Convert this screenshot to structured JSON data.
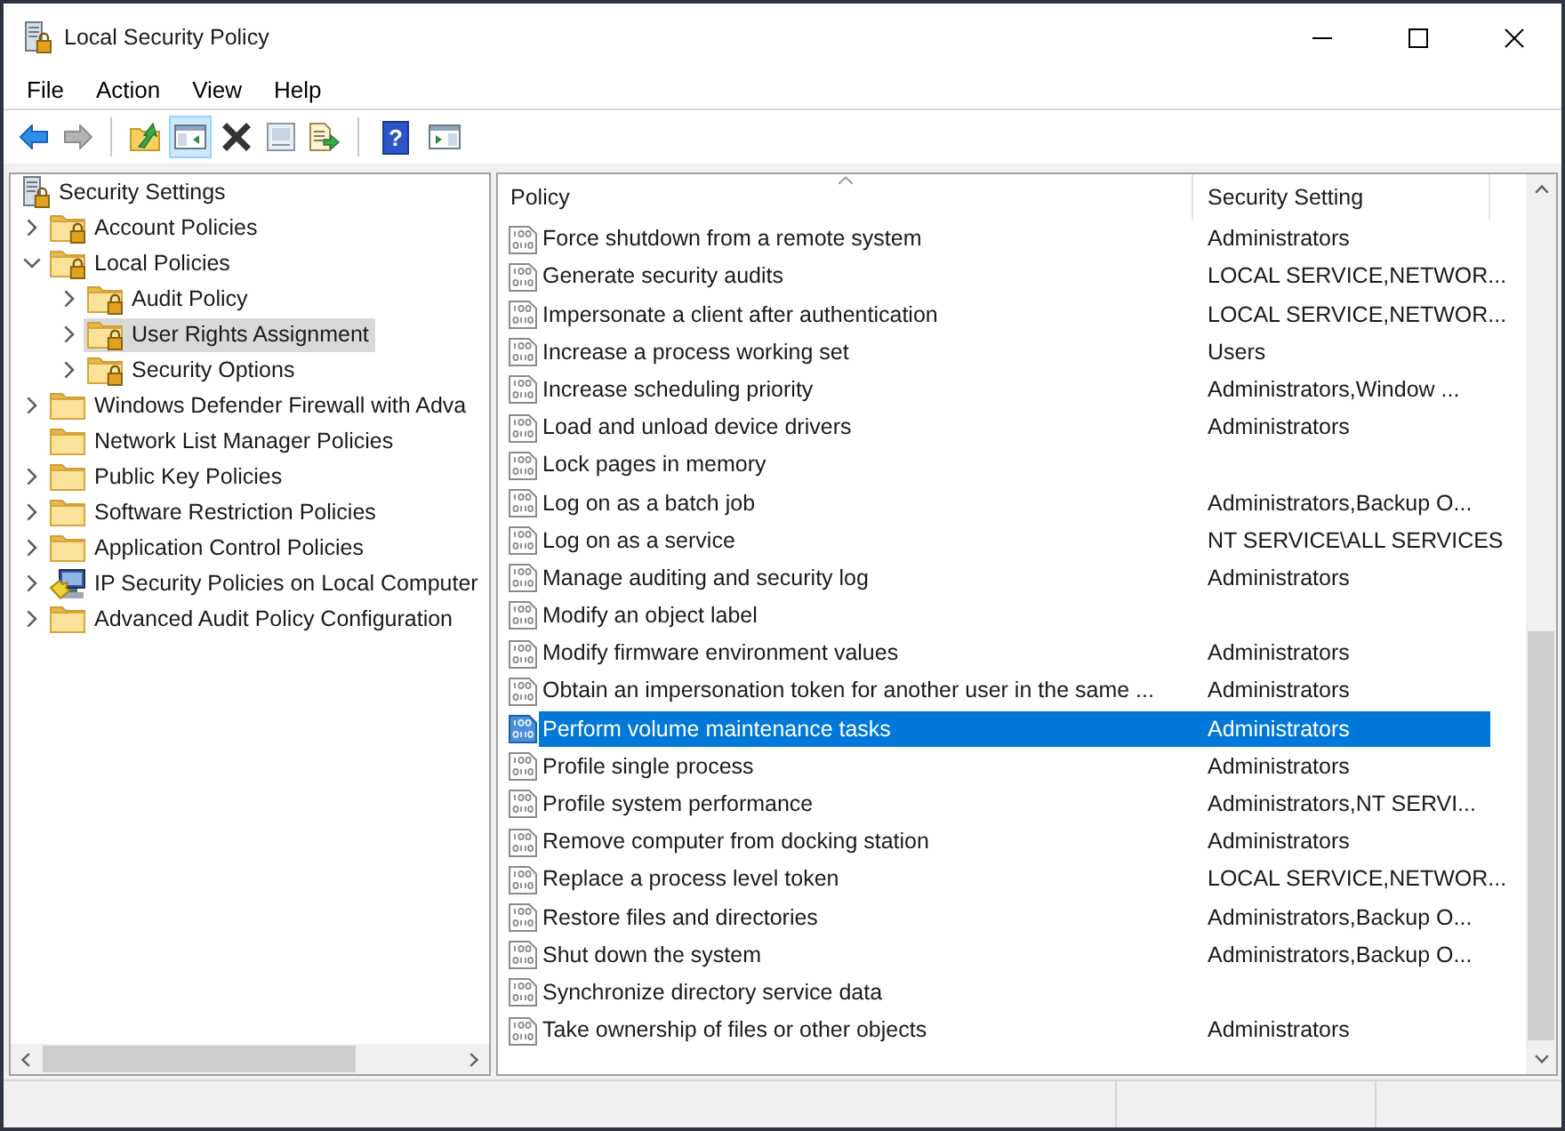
{
  "window": {
    "title": "Local Security Policy"
  },
  "menu": [
    "File",
    "Action",
    "View",
    "Help"
  ],
  "toolbar": {
    "groups": [
      [
        {
          "kind": "back",
          "disabled": false,
          "pressed": false
        },
        {
          "kind": "forward",
          "disabled": true,
          "pressed": false
        }
      ],
      [
        {
          "kind": "up",
          "disabled": false,
          "pressed": false
        },
        {
          "kind": "tree-toggle",
          "disabled": false,
          "pressed": true
        },
        {
          "kind": "delete",
          "disabled": false,
          "pressed": false
        },
        {
          "kind": "properties",
          "disabled": false,
          "pressed": false
        },
        {
          "kind": "export",
          "disabled": false,
          "pressed": false
        }
      ],
      [
        {
          "kind": "help",
          "label": "?",
          "disabled": false,
          "pressed": false
        },
        {
          "kind": "action-pane",
          "disabled": false,
          "pressed": false
        }
      ]
    ]
  },
  "tree": [
    {
      "label": "Security Settings",
      "kind": "root",
      "selected": false,
      "children": [
        {
          "label": "Account Policies",
          "kind": "locked-folder",
          "expandable": true,
          "expanded": false,
          "selected": false
        },
        {
          "label": "Local Policies",
          "kind": "locked-folder",
          "expandable": true,
          "expanded": true,
          "selected": false,
          "children": [
            {
              "label": "Audit Policy",
              "kind": "locked-folder",
              "expandable": true,
              "expanded": false,
              "selected": false
            },
            {
              "label": "User Rights Assignment",
              "kind": "locked-folder",
              "expandable": true,
              "expanded": false,
              "selected": true
            },
            {
              "label": "Security Options",
              "kind": "locked-folder",
              "expandable": true,
              "expanded": false,
              "selected": false
            }
          ]
        },
        {
          "label": "Windows Defender Firewall with Adva",
          "kind": "folder",
          "expandable": true,
          "expanded": false,
          "selected": false
        },
        {
          "label": "Network List Manager Policies",
          "kind": "folder",
          "expandable": false,
          "selected": false
        },
        {
          "label": "Public Key Policies",
          "kind": "folder",
          "expandable": true,
          "expanded": false,
          "selected": false
        },
        {
          "label": "Software Restriction Policies",
          "kind": "folder",
          "expandable": true,
          "expanded": false,
          "selected": false
        },
        {
          "label": "Application Control Policies",
          "kind": "folder",
          "expandable": true,
          "expanded": false,
          "selected": false
        },
        {
          "label": "IP Security Policies on Local Computer",
          "kind": "computer",
          "expandable": true,
          "expanded": false,
          "selected": false
        },
        {
          "label": "Advanced Audit Policy Configuration",
          "kind": "folder",
          "expandable": true,
          "expanded": false,
          "selected": false
        }
      ]
    }
  ],
  "policy_list": {
    "columns": [
      {
        "label": "Policy",
        "sorted": true
      },
      {
        "label": "Security Setting",
        "sorted": false
      }
    ],
    "rows": [
      {
        "policy": "Force shutdown from a remote system",
        "setting": "Administrators",
        "selected": false
      },
      {
        "policy": "Generate security audits",
        "setting": "LOCAL SERVICE,NETWOR...",
        "selected": false
      },
      {
        "policy": "Impersonate a client after authentication",
        "setting": "LOCAL SERVICE,NETWOR...",
        "selected": false
      },
      {
        "policy": "Increase a process working set",
        "setting": "Users",
        "selected": false
      },
      {
        "policy": "Increase scheduling priority",
        "setting": "Administrators,Window ...",
        "selected": false
      },
      {
        "policy": "Load and unload device drivers",
        "setting": "Administrators",
        "selected": false
      },
      {
        "policy": "Lock pages in memory",
        "selected": false
      },
      {
        "policy": "Log on as a batch job",
        "setting": "Administrators,Backup O...",
        "selected": false
      },
      {
        "policy": "Log on as a service",
        "setting": "NT SERVICE\\ALL SERVICES",
        "selected": false
      },
      {
        "policy": "Manage auditing and security log",
        "setting": "Administrators",
        "selected": false
      },
      {
        "policy": "Modify an object label",
        "selected": false
      },
      {
        "policy": "Modify firmware environment values",
        "setting": "Administrators",
        "selected": false
      },
      {
        "policy": "Obtain an impersonation token for another user in the same ...",
        "setting": "Administrators",
        "selected": false
      },
      {
        "policy": "Perform volume maintenance tasks",
        "setting": "Administrators",
        "selected": true
      },
      {
        "policy": "Profile single process",
        "setting": "Administrators",
        "selected": false
      },
      {
        "policy": "Profile system performance",
        "setting": "Administrators,NT SERVI...",
        "selected": false
      },
      {
        "policy": "Remove computer from docking station",
        "setting": "Administrators",
        "selected": false
      },
      {
        "policy": "Replace a process level token",
        "setting": "LOCAL SERVICE,NETWOR...",
        "selected": false
      },
      {
        "policy": "Restore files and directories",
        "setting": "Administrators,Backup O...",
        "selected": false
      },
      {
        "policy": "Shut down the system",
        "setting": "Administrators,Backup O...",
        "selected": false
      },
      {
        "policy": "Synchronize directory service data",
        "selected": false
      },
      {
        "policy": "Take ownership of files or other objects",
        "setting": "Administrators",
        "selected": false
      }
    ]
  }
}
